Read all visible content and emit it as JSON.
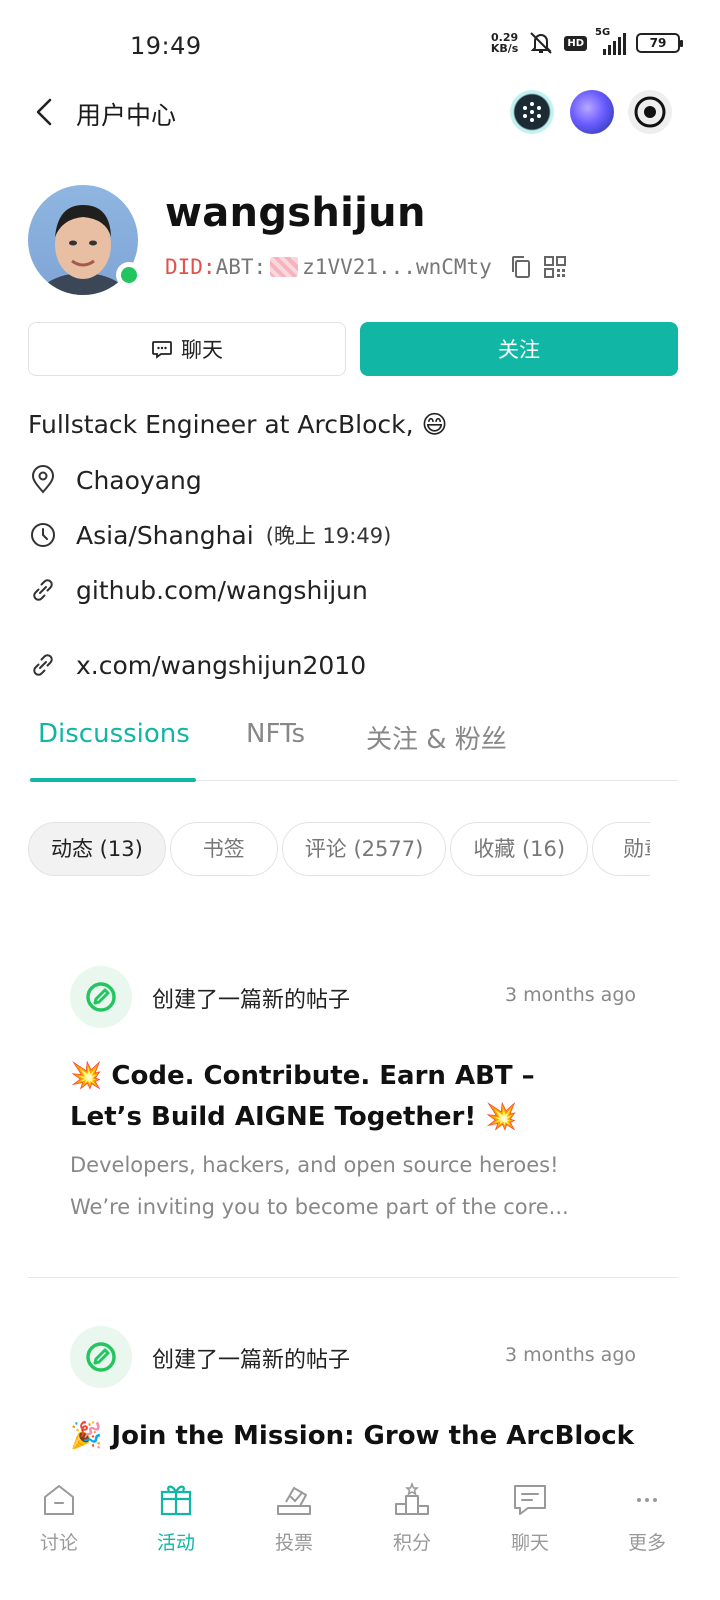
{
  "status": {
    "time": "19:49",
    "net_speed_value": "0.29",
    "net_speed_unit": "KB/s",
    "hd": "HD",
    "network": "5G",
    "battery": "79"
  },
  "header": {
    "title": "用户中心"
  },
  "profile": {
    "username": "wangshijun",
    "did_prefix": "DID:",
    "did_chain": "ABT:",
    "did_value": "z1VV21...wnCMty",
    "online": true,
    "bio": "Fullstack Engineer at ArcBlock, 😄",
    "location": "Chaoyang",
    "timezone": "Asia/Shanghai",
    "timezone_local": "(晚上 19:49)",
    "links": [
      "github.com/wangshijun",
      "x.com/wangshijun2010"
    ]
  },
  "actions": {
    "chat_label": "聊天",
    "follow_label": "关注"
  },
  "tabs": [
    {
      "label": "Discussions",
      "active": true
    },
    {
      "label": "NFTs",
      "active": false
    },
    {
      "label": "关注 & 粉丝",
      "active": false
    }
  ],
  "filters": [
    {
      "label": "动态 (13)",
      "active": true
    },
    {
      "label": "书签",
      "active": false
    },
    {
      "label": "评论 (2577)",
      "active": false
    },
    {
      "label": "收藏 (16)",
      "active": false
    },
    {
      "label": "勋章",
      "active": false
    }
  ],
  "posts": [
    {
      "action": "创建了一篇新的帖子",
      "time": "3 months ago",
      "title": "💥 Code. Contribute. Earn ABT – Let’s Build AIGNE Together! 💥",
      "excerpt_line1": "Developers, hackers, and open source heroes!",
      "excerpt_line2": "We’re inviting you to become part of the core..."
    },
    {
      "action": "创建了一篇新的帖子",
      "time": "3 months ago",
      "title": "🎉 Join the Mission: Grow the ArcBlock"
    }
  ],
  "nav": [
    {
      "label": "讨论",
      "icon": "home-icon",
      "active": false
    },
    {
      "label": "活动",
      "icon": "gift-icon",
      "active": true
    },
    {
      "label": "投票",
      "icon": "vote-icon",
      "active": false
    },
    {
      "label": "积分",
      "icon": "podium-icon",
      "active": false
    },
    {
      "label": "聊天",
      "icon": "chat-icon",
      "active": false
    },
    {
      "label": "更多",
      "icon": "more-icon",
      "active": false
    }
  ],
  "colors": {
    "accent": "#11b6a4",
    "did_prefix": "#e0524a",
    "online": "#22c55e",
    "post_icon": "#22c55e"
  }
}
